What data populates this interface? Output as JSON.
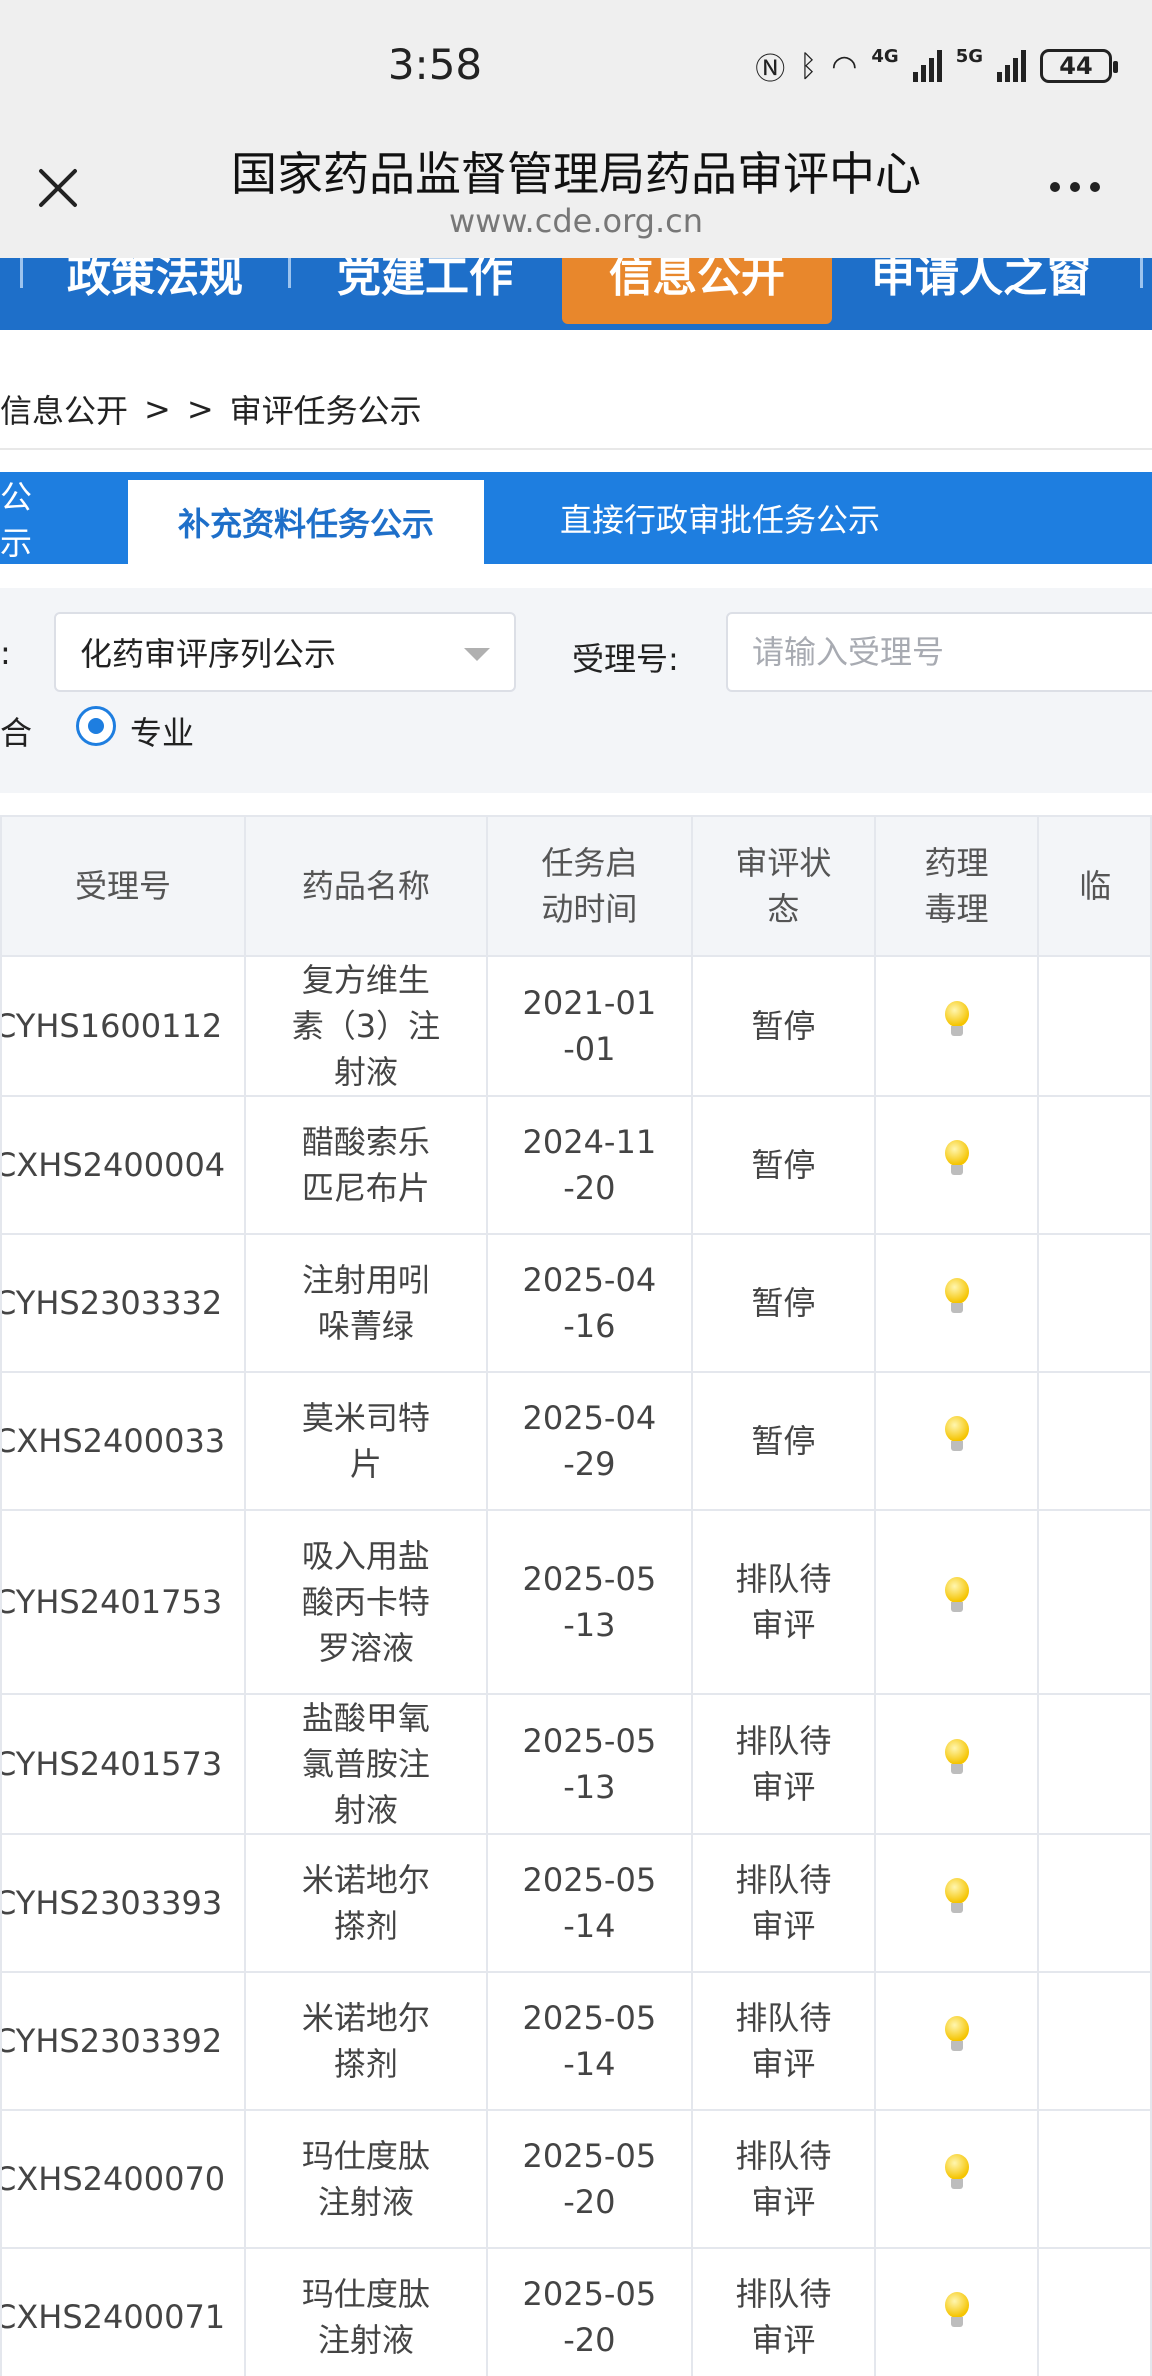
{
  "status_bar": {
    "time": "3:58",
    "network_4g": "4G",
    "network_5g": "5G",
    "battery": "44"
  },
  "browser": {
    "title": "国家药品监督管理局药品审评中心",
    "url": "www.cde.org.cn"
  },
  "top_nav": {
    "items": [
      "政策法规",
      "党建工作",
      "信息公开",
      "申请人之窗"
    ],
    "active": "信息公开"
  },
  "breadcrumb": {
    "items": [
      "信息公开",
      ">",
      ">",
      "审评任务公示"
    ]
  },
  "tabs": {
    "items": [
      "公示",
      "补充资料任务公示",
      "直接行政审批任务公示"
    ],
    "active": "补充资料任务公示"
  },
  "filters": {
    "sequence_label": ":",
    "sequence_value": "化药审评序列公示",
    "acceptance_label": "受理号:",
    "acceptance_placeholder": "请输入受理号",
    "combo_label": "合",
    "radio_label": "专业"
  },
  "table": {
    "headers": [
      "受理号",
      "药品名称",
      "任务启动时间",
      "审评状态",
      "药理毒理",
      "临"
    ],
    "rows": [
      {
        "id": "CYHS1600112",
        "name": "复方维生素（3）注射液",
        "date": "2021-01-01",
        "status": "暂停"
      },
      {
        "id": "CXHS2400004",
        "name": "醋酸索乐匹尼布片",
        "date": "2024-11-20",
        "status": "暂停"
      },
      {
        "id": "CYHS2303332",
        "name": "注射用吲哚菁绿",
        "date": "2025-04-16",
        "status": "暂停"
      },
      {
        "id": "CXHS2400033",
        "name": "莫米司特片",
        "date": "2025-04-29",
        "status": "暂停"
      },
      {
        "id": "CYHS2401753",
        "name": "吸入用盐酸丙卡特罗溶液",
        "date": "2025-05-13",
        "status": "排队待审评"
      },
      {
        "id": "CYHS2401573",
        "name": "盐酸甲氧氯普胺注射液",
        "date": "2025-05-13",
        "status": "排队待审评"
      },
      {
        "id": "CYHS2303393",
        "name": "米诺地尔搽剂",
        "date": "2025-05-14",
        "status": "排队待审评"
      },
      {
        "id": "CYHS2303392",
        "name": "米诺地尔搽剂",
        "date": "2025-05-14",
        "status": "排队待审评"
      },
      {
        "id": "CXHS2400070",
        "name": "玛仕度肽注射液",
        "date": "2025-05-20",
        "status": "排队待审评"
      },
      {
        "id": "CXHS2400071",
        "name": "玛仕度肽注射液",
        "date": "2025-05-20",
        "status": "排队待审评"
      }
    ]
  },
  "colors": {
    "primary_blue": "#1e7ee0",
    "nav_blue": "#1e6fc9",
    "active_orange": "#e8872c"
  }
}
